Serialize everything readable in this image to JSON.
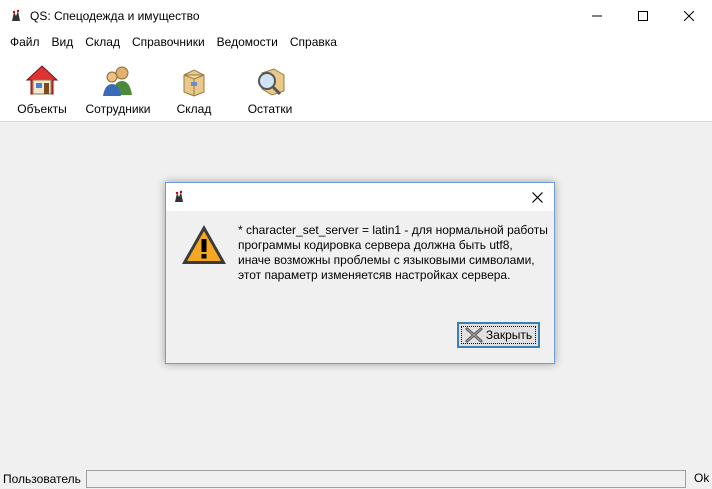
{
  "window": {
    "title": "QS: Спецодежда и имущество",
    "app_icon": "jester-icon"
  },
  "menu": [
    "Файл",
    "Вид",
    "Склад",
    "Справочники",
    "Ведомости",
    "Справка"
  ],
  "toolbar": {
    "items": [
      {
        "label": "Объекты",
        "icon": "house-icon"
      },
      {
        "label": "Сотрудники",
        "icon": "users-icon"
      },
      {
        "label": "Склад",
        "icon": "box-icon"
      },
      {
        "label": "Остатки",
        "icon": "magnifier-icon"
      }
    ]
  },
  "dialog": {
    "message_lines": [
      "* character_set_server = latin1 - для нормальной работы",
      "программы кодировка сервера должна быть utf8,",
      "иначе возможны проблемы с языковыми символами,",
      "этот параметр изменяетсяв настройках сервера."
    ],
    "close_button": "Закрыть",
    "icon": "warning-icon"
  },
  "statusbar": {
    "user_label": "Пользователь",
    "user_value": "",
    "right_text": "Ok"
  },
  "colors": {
    "accent": "#3c7fb1",
    "dialog_border": "#6b9ed6",
    "warning_fill": "#f5a623"
  }
}
